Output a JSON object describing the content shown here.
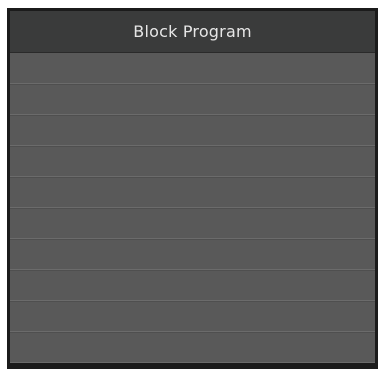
{
  "header": {
    "title": "Block Program"
  },
  "list": {
    "rows": [
      "",
      "",
      "",
      "",
      "",
      "",
      "",
      "",
      "",
      ""
    ]
  },
  "colors": {
    "title_bar": "#3a3b3b",
    "list_background": "#585858",
    "divider": "#6b6b6b",
    "frame": "#1b1b1b",
    "title_text": "#e6e6e6"
  }
}
